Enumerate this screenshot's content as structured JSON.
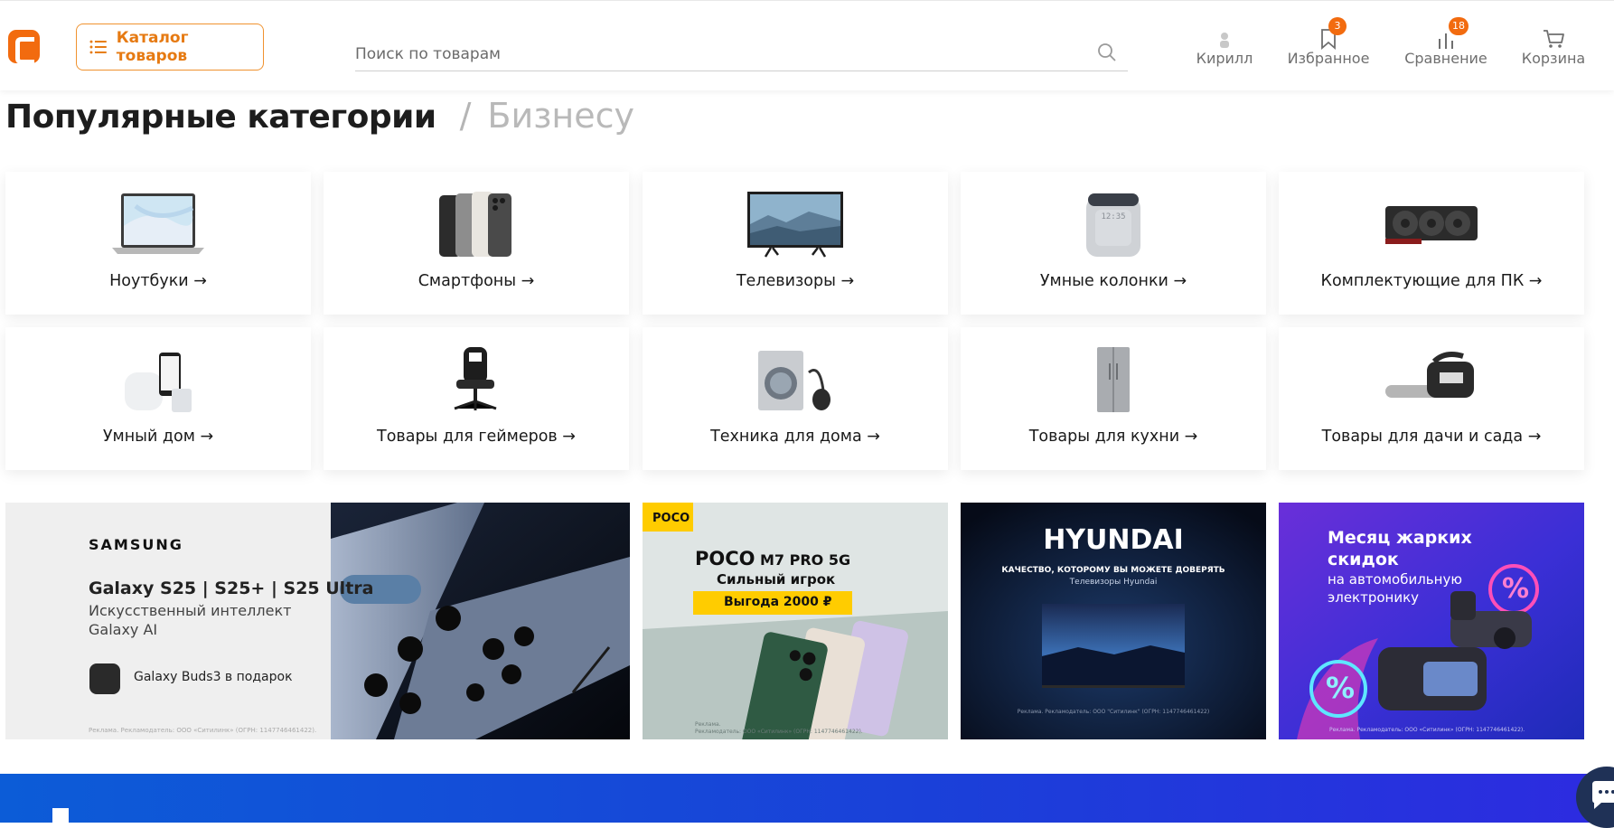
{
  "header": {
    "catalog_label": "Каталог товаров",
    "search_placeholder": "Поиск по товарам",
    "nav": [
      {
        "label": "Кирилл",
        "icon": "user-icon"
      },
      {
        "label": "Избранное",
        "icon": "bookmark-icon",
        "badge": "3"
      },
      {
        "label": "Сравнение",
        "icon": "compare-icon",
        "badge": "18"
      },
      {
        "label": "Корзина",
        "icon": "cart-icon"
      }
    ]
  },
  "section": {
    "title": "Популярные категории",
    "separator": "/",
    "alt_tab": "Бизнесу"
  },
  "categories": [
    {
      "label": "Ноутбуки →",
      "icon": "laptop-icon"
    },
    {
      "label": "Смартфоны →",
      "icon": "smartphones-icon"
    },
    {
      "label": "Телевизоры →",
      "icon": "tv-icon"
    },
    {
      "label": "Умные колонки →",
      "icon": "smart-speaker-icon"
    },
    {
      "label": "Комплектующие для ПК →",
      "icon": "gpu-icon"
    },
    {
      "label": "Умный дом →",
      "icon": "smart-home-icon"
    },
    {
      "label": "Товары для геймеров →",
      "icon": "gaming-chair-icon"
    },
    {
      "label": "Техника для дома →",
      "icon": "washing-machine-icon"
    },
    {
      "label": "Товары для кухни →",
      "icon": "fridge-icon"
    },
    {
      "label": "Товары для дачи и сада →",
      "icon": "chainsaw-icon"
    }
  ],
  "banners": {
    "samsung": {
      "brand": "SAMSUNG",
      "models": "Galaxy S25 | S25+ | S25 Ultra",
      "line1": "Искусственный интеллект",
      "line2": "Galaxy AI",
      "gift": "Galaxy Buds3 в подарок",
      "legal": "Реклама. Рекламодатель: ООО «Ситилинк» (ОГРН: 1147746461422)."
    },
    "poco": {
      "tag": "POCO",
      "model_a": "POCO",
      "model_b": "M7 PRO 5G",
      "slogan": "Сильный игрок",
      "promo": "Выгода 2000 ₽",
      "legal1": "Реклама.",
      "legal2": "Рекламодатель: ООО «Ситилинк» (ОГРН: 1147746461422)."
    },
    "hyundai": {
      "brand": "HYUNDAI",
      "line1": "КАЧЕСТВО, КОТОРОМУ ВЫ МОЖЕТЕ ДОВЕРЯТЬ",
      "line2": "Телевизоры Hyundai",
      "legal": "Реклама. Рекламодатель: ООО \"Ситилинк\" (ОГРН: 1147746461422)"
    },
    "auto": {
      "line1": "Месяц жарких",
      "line2": "скидок",
      "line3": "на автомобильную",
      "line4": "электронику",
      "percent": "%",
      "legal": "Реклама. Рекламодатель: ООО «Ситилинк» (ОГРН: 1147746461422)."
    }
  },
  "colors": {
    "accent": "#f26b0f",
    "band": "#1b3fd9"
  }
}
